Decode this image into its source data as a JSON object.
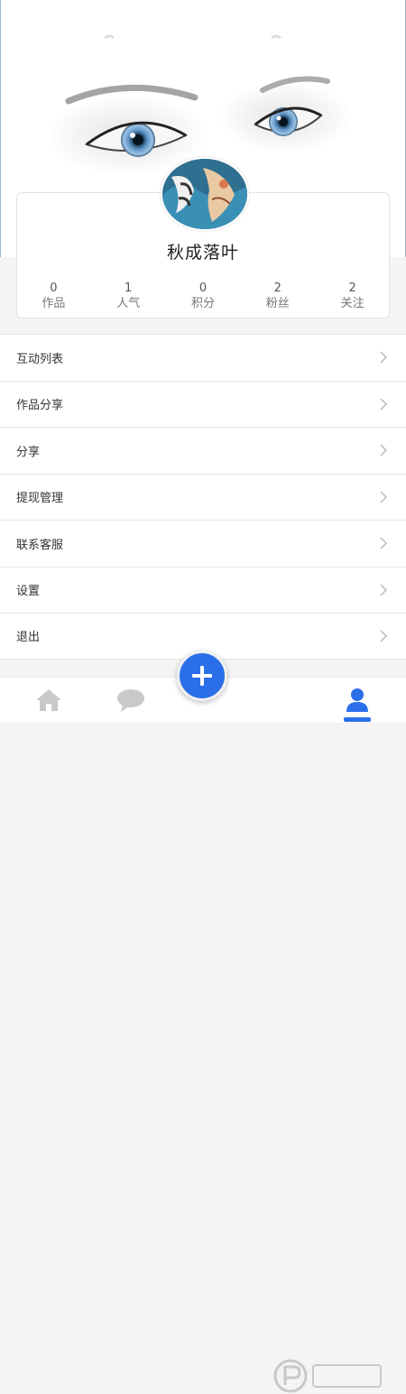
{
  "profile": {
    "username": "秋成落叶",
    "stats": [
      {
        "value": "0",
        "label": "作品"
      },
      {
        "value": "1",
        "label": "人气"
      },
      {
        "value": "0",
        "label": "积分"
      },
      {
        "value": "2",
        "label": "粉丝"
      },
      {
        "value": "2",
        "label": "关注"
      }
    ]
  },
  "menu": {
    "items": [
      {
        "label": "互动列表"
      },
      {
        "label": "作品分享"
      },
      {
        "label": "分享"
      },
      {
        "label": "提现管理"
      },
      {
        "label": "联系客服"
      },
      {
        "label": "设置"
      },
      {
        "label": "退出"
      }
    ]
  },
  "tabbar": {
    "items": [
      {
        "icon": "home-icon"
      },
      {
        "icon": "chat-icon"
      },
      {
        "icon": "add-icon"
      },
      {
        "icon": "user-icon"
      }
    ],
    "active_color": "#2b6fe8"
  },
  "colors": {
    "accent": "#2b6fe8",
    "background": "#f4f4f4"
  }
}
